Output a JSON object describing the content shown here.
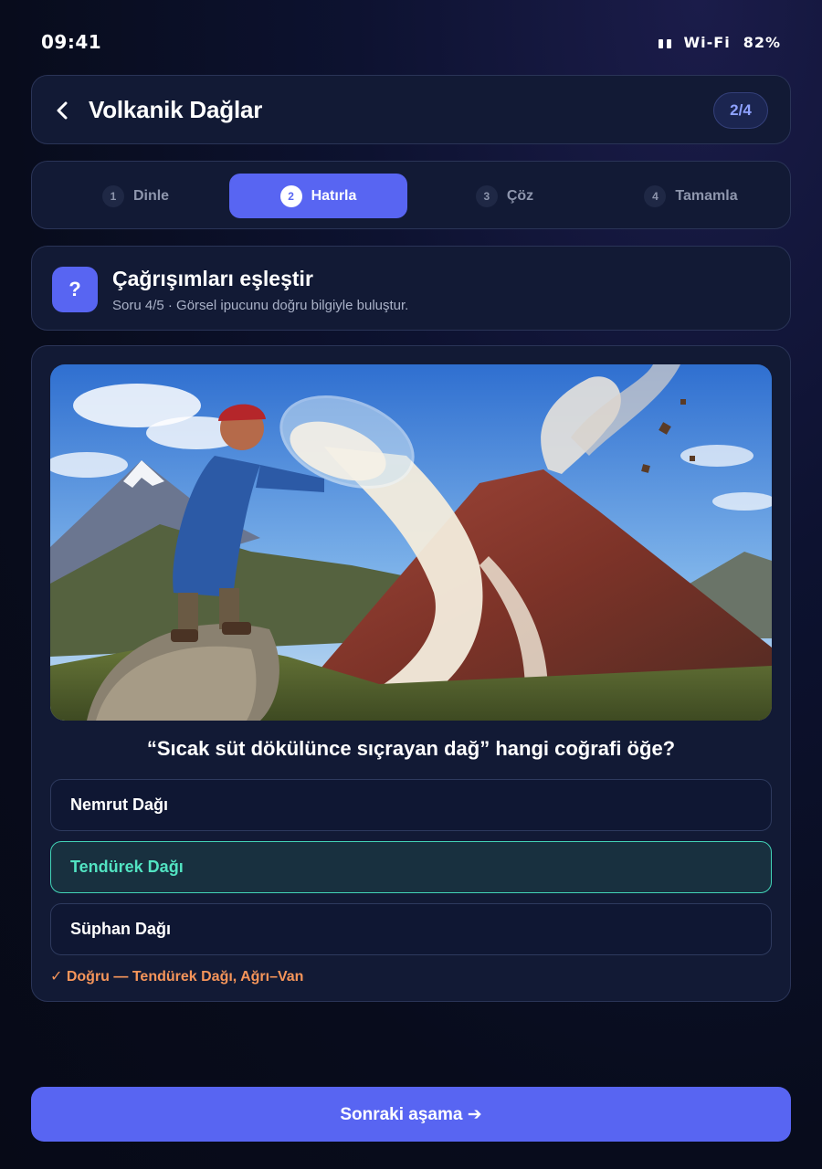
{
  "status_bar": {
    "time": "09:41",
    "wifi": "Wi-Fi",
    "battery": "82%"
  },
  "header": {
    "title": "Volkanik Dağlar",
    "progress": "2/4"
  },
  "steps": [
    {
      "number": "1",
      "label": "Dinle",
      "active": false
    },
    {
      "number": "2",
      "label": "Hatırla",
      "active": true
    },
    {
      "number": "3",
      "label": "Çöz",
      "active": false
    },
    {
      "number": "4",
      "label": "Tamamla",
      "active": false
    }
  ],
  "task": {
    "icon": "?",
    "title": "Çağrışımları eşleştir",
    "subtitle": "Soru 4/5 · Görsel ipucunu doğru bilgiyle buluştur."
  },
  "quiz": {
    "question": "“Sıcak süt dökülünce sıçrayan dağ” hangi coğrafi öğe?",
    "options": [
      {
        "label": "Nemrut Dağı",
        "state": "default"
      },
      {
        "label": "Tendürek Dağı",
        "state": "correct"
      },
      {
        "label": "Süphan Dağı",
        "state": "default"
      }
    ],
    "feedback": "✓ Doğru — Tendürek Dağı, Ağrı–Van"
  },
  "next_button": {
    "label": "Sonraki aşama ➔"
  },
  "colors": {
    "accent": "#5865f2",
    "correct": "#52e3c2",
    "feedback": "#f6955a"
  }
}
